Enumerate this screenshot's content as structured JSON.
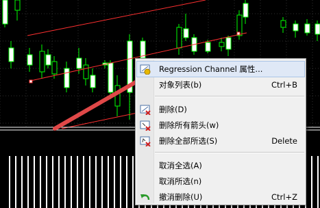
{
  "colors": {
    "background": "#000000",
    "candle_up": "#ffffff",
    "candle_down": "#000000",
    "wick": "#00ff00",
    "channel_line": "#ff3030",
    "arrow": "#e04040",
    "grid": "#303030"
  },
  "context_menu": {
    "items": [
      {
        "label": "Regression Channel 属性...",
        "shortcut": "",
        "icon": "regression-properties-icon",
        "highlighted": true
      },
      {
        "label": "对象列表(b)",
        "shortcut": "Ctrl+B",
        "icon": "",
        "highlighted": false
      },
      {
        "label": "删除(D)",
        "shortcut": "",
        "icon": "delete-object-icon",
        "highlighted": false
      },
      {
        "label": "删除所有箭头(w)",
        "shortcut": "",
        "icon": "delete-arrows-icon",
        "highlighted": false
      },
      {
        "label": "删除全部所选(S)",
        "shortcut": "Delete",
        "icon": "delete-selected-icon",
        "highlighted": false
      },
      {
        "label": "取消全选(A)",
        "shortcut": "",
        "icon": "",
        "highlighted": false
      },
      {
        "label": "取消所选(n)",
        "shortcut": "",
        "icon": "",
        "highlighted": false
      },
      {
        "label": "撤消删除(U)",
        "shortcut": "Ctrl+Z",
        "icon": "undo-icon",
        "highlighted": false
      }
    ]
  }
}
